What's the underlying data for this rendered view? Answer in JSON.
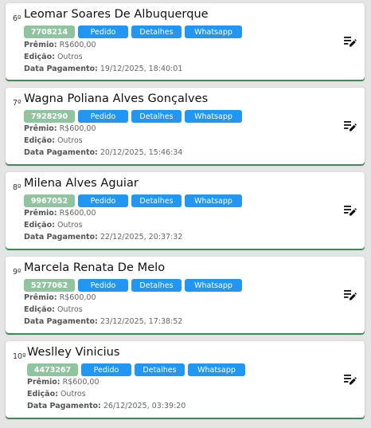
{
  "labels": {
    "premio": "Prêmio:",
    "edicao": "Edição:",
    "data_pagamento": "Data Pagamento:"
  },
  "buttons": {
    "pedido": "Pedido",
    "detalhes": "Detalhes",
    "whatsapp": "Whatsapp"
  },
  "colors": {
    "code_badge": "#8fc49e",
    "button": "#2196f3",
    "card_accent": "#3f8c5a"
  },
  "cards": [
    {
      "position": "6º",
      "name": "Leomar Soares De Albuquerque",
      "code": "7708214",
      "premio": "R$600,00",
      "edicao": "Outros",
      "data_pagamento": "19/12/2025, 18:40:01"
    },
    {
      "position": "7º",
      "name": "Wagna Poliana Alves Gonçalves",
      "code": "7928290",
      "premio": "R$600,00",
      "edicao": "Outros",
      "data_pagamento": "20/12/2025, 15:46:34"
    },
    {
      "position": "8º",
      "name": "Milena Alves Aguiar",
      "code": "9967052",
      "premio": "R$600,00",
      "edicao": "Outros",
      "data_pagamento": "22/12/2025, 20:37:32"
    },
    {
      "position": "9º",
      "name": "Marcela Renata De Melo",
      "code": "5277062",
      "premio": "R$600,00",
      "edicao": "Outros",
      "data_pagamento": "23/12/2025, 17:38:52"
    },
    {
      "position": "10º",
      "name": "Weslley Vinicius",
      "code": "4473267",
      "premio": "R$600,00",
      "edicao": "Outros",
      "data_pagamento": "26/12/2025, 03:39:20"
    }
  ]
}
